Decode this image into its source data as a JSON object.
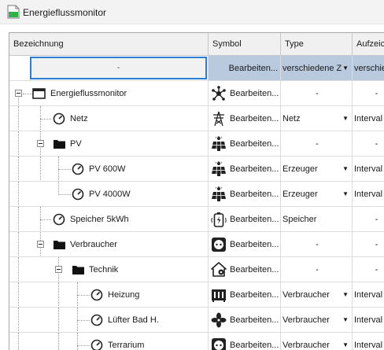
{
  "window": {
    "title": "Energieflussmonitor"
  },
  "columns": {
    "name": "Bezeichnung",
    "symbol": "Symbol",
    "type": "Type",
    "aggregation": "Aufzeic"
  },
  "filter_row": {
    "name": "-",
    "symbol": "Bearbeiten...",
    "type": "verschiedene Z",
    "aggregation": "verschie"
  },
  "rows": [
    {
      "label": "Energieflussmonitor",
      "symbol_icon": "network-nodes-icon",
      "symbol": "Bearbeiten...",
      "type": "-",
      "aggregation": "-"
    },
    {
      "label": "Netz",
      "symbol_icon": "power-tower-icon",
      "symbol": "Bearbeiten...",
      "type": "Netz",
      "aggregation": "Interval"
    },
    {
      "label": "PV",
      "symbol_icon": "solar-panel-icon",
      "symbol": "Bearbeiten...",
      "type": "-",
      "aggregation": "-"
    },
    {
      "label": "PV 600W",
      "symbol_icon": "solar-panel-icon",
      "symbol": "Bearbeiten...",
      "type": "Erzeuger",
      "aggregation": "Interval"
    },
    {
      "label": "PV 4000W",
      "symbol_icon": "solar-panel-icon",
      "symbol": "Bearbeiten...",
      "type": "Erzeuger",
      "aggregation": "Interval"
    },
    {
      "label": "Speicher 5kWh",
      "symbol_icon": "battery-storage-icon",
      "symbol": "Bearbeiten...",
      "type": "Speicher",
      "aggregation": "-"
    },
    {
      "label": "Verbraucher",
      "symbol_icon": "power-outlet-icon",
      "symbol": "Bearbeiten...",
      "type": "-",
      "aggregation": "-"
    },
    {
      "label": "Technik",
      "symbol_icon": "house-gear-icon",
      "symbol": "Bearbeiten...",
      "type": "-",
      "aggregation": "-"
    },
    {
      "label": "Heizung",
      "symbol_icon": "heater-icon",
      "symbol": "Bearbeiten...",
      "type": "Verbraucher",
      "aggregation": "Interval"
    },
    {
      "label": "Lüfter Bad H.",
      "symbol_icon": "fan-icon",
      "symbol": "Bearbeiten...",
      "type": "Verbraucher",
      "aggregation": "Interval"
    },
    {
      "label": "Terrarium",
      "symbol_icon": "power-outlet-icon",
      "symbol": "Bearbeiten...",
      "type": "Verbraucher",
      "aggregation": "Interval"
    }
  ]
}
